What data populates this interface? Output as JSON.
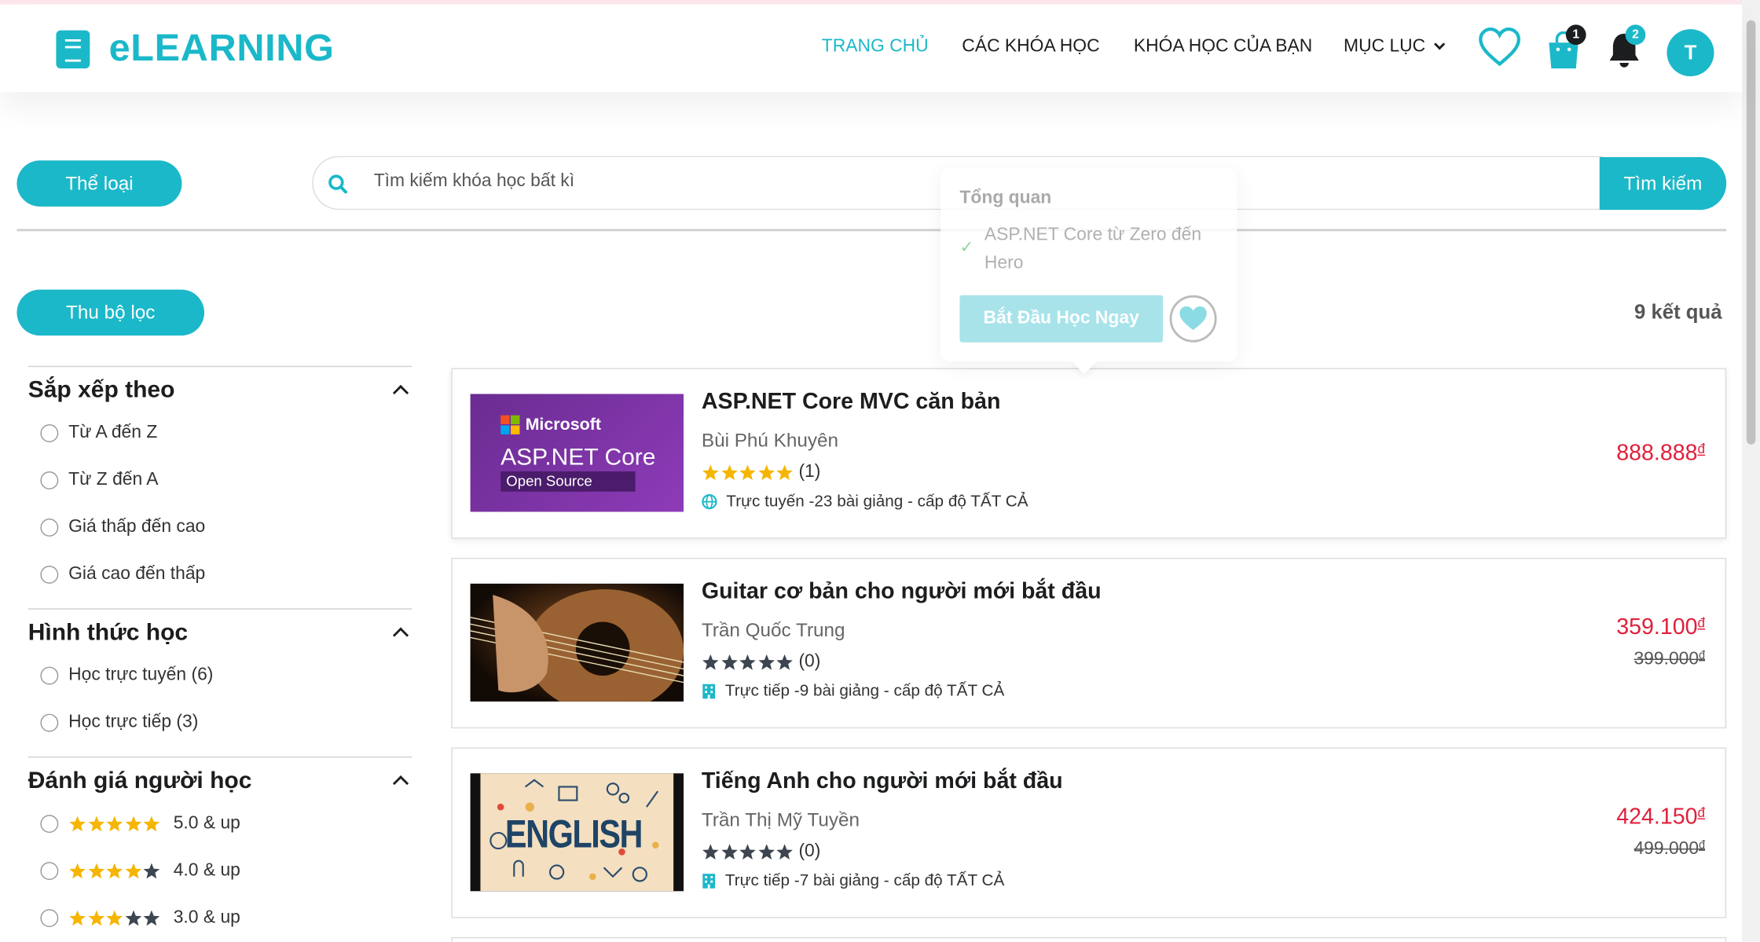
{
  "header": {
    "brand": "eLEARNING",
    "nav": [
      "TRANG CHỦ",
      "CÁC KHÓA HỌC",
      "KHÓA HỌC CỦA BẠN",
      "MỤC LỤC"
    ],
    "cart_count": "1",
    "notif_count": "2",
    "avatar_letter": "T",
    "accent_color": "#1bb8c9"
  },
  "toolbar": {
    "category_label": "Thể loại",
    "search_placeholder": "Tìm kiếm khóa học bất kì",
    "search_button": "Tìm kiếm",
    "filter_toggle": "Thu bộ lọc",
    "results": "9 kết quả"
  },
  "sidebar": {
    "sort": {
      "title": "Sắp xếp theo",
      "options": [
        "Từ A đến Z",
        "Từ Z đến A",
        "Giá thấp đến cao",
        "Giá cao đến thấp"
      ]
    },
    "mode": {
      "title": "Hình thức học",
      "options": [
        "Học trực tuyến (6)",
        "Học trực tiếp (3)"
      ]
    },
    "rating": {
      "title": "Đánh giá người học",
      "options": [
        {
          "label": "5.0 & up",
          "stars": 5
        },
        {
          "label": "4.0 & up",
          "stars": 4
        },
        {
          "label": "3.0 & up",
          "stars": 3
        }
      ]
    }
  },
  "popover": {
    "title": "Tổng quan",
    "item": "ASP.NET Core từ Zero đến Hero",
    "button": "Bắt Đầu Học Ngay"
  },
  "courses": [
    {
      "title": "ASP.NET Core MVC căn bản",
      "author": "Bùi Phú Khuyên",
      "rating_count": "(1)",
      "meta": "Trực tuyến -23 bài giảng - cấp độ TẤT CẢ",
      "price": "888.888",
      "currency": "đ",
      "thumb_brand": "Microsoft",
      "thumb_title": "ASP.NET Core",
      "thumb_sub": "Open Source"
    },
    {
      "title": "Guitar cơ bản cho người mới bắt đầu",
      "author": "Trần Quốc Trung",
      "rating_count": "(0)",
      "meta": "Trực tiếp -9 bài giảng - cấp độ TẤT CẢ",
      "price": "359.100",
      "old_price": "399.000",
      "currency": "đ"
    },
    {
      "title": "Tiếng Anh cho người mới bắt đầu",
      "author": "Trần Thị Mỹ Tuyền",
      "rating_count": "(0)",
      "meta": "Trực tiếp -7 bài giảng - cấp độ TẤT CẢ",
      "price": "424.150",
      "old_price": "499.000",
      "currency": "đ",
      "thumb_word": "ENGLISH"
    }
  ]
}
